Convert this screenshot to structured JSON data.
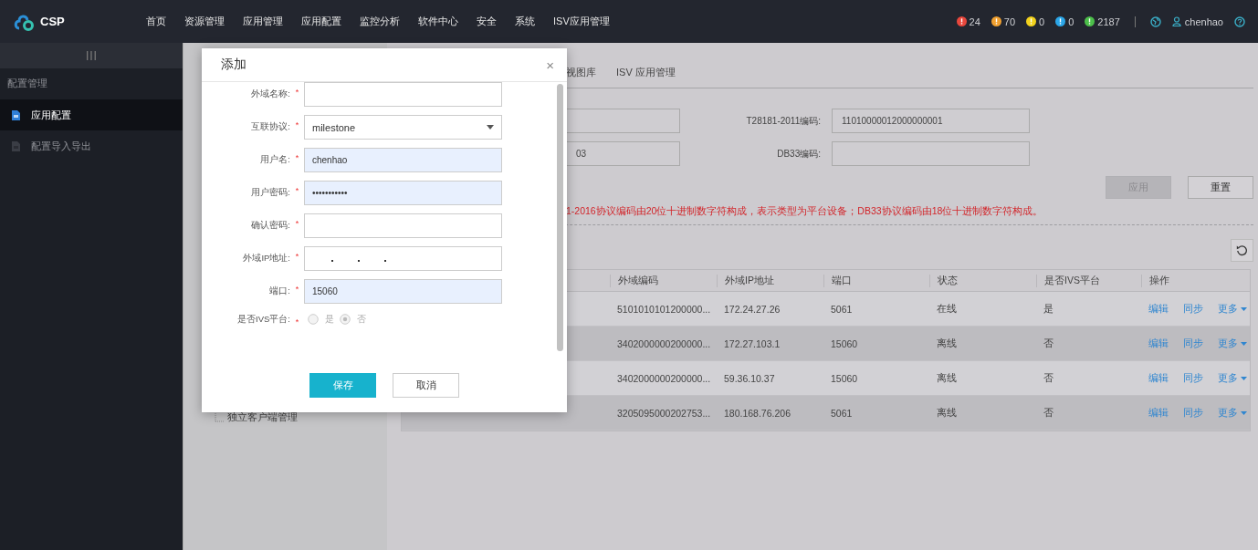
{
  "top_bar": {
    "logo_text": "CSP",
    "nav": [
      {
        "label": "首页"
      },
      {
        "label": "资源管理"
      },
      {
        "label": "应用管理"
      },
      {
        "label": "应用配置"
      },
      {
        "label": "监控分析"
      },
      {
        "label": "软件中心"
      },
      {
        "label": "安全"
      },
      {
        "label": "系统"
      },
      {
        "label": "ISV应用管理"
      }
    ],
    "alarms": [
      {
        "count": "24",
        "color": "#e8473c"
      },
      {
        "count": "70",
        "color": "#f0a030"
      },
      {
        "count": "0",
        "color": "#f2d21c"
      },
      {
        "count": "0",
        "color": "#2ba6e8"
      },
      {
        "count": "2187",
        "color": "#4cbf4a"
      }
    ],
    "user": "chenhao"
  },
  "sidebar": {
    "header": "配置管理",
    "items": [
      {
        "label": "应用配置",
        "selected": true
      },
      {
        "label": "配置导入导出",
        "selected": false
      }
    ]
  },
  "tree": {
    "items": [
      {
        "label": "独立客户端管理"
      }
    ]
  },
  "tabs": [
    {
      "label": "视图库",
      "selected": false
    },
    {
      "label": "ISV 应用管理",
      "selected": false
    }
  ],
  "codes": {
    "rows": [
      {
        "label": "T28181-2011编码:",
        "value": "11010000012000000001"
      },
      {
        "left_value": "03",
        "label": "DB33编码:"
      }
    ],
    "buttons": [
      {
        "label": "应用",
        "disabled": true
      },
      {
        "label": "重置",
        "disabled": false
      }
    ],
    "note": "1-2016协议编码由20位十进制数字符构成，表示类型为平台设备；DB33协议编码由18位十进制数字符构成。"
  },
  "table": {
    "columns": [
      "外域编码",
      "外域IP地址",
      "端口",
      "状态",
      "是否IVS平台",
      "操作"
    ],
    "rows": [
      {
        "code": "5101010101200000...",
        "ip": "172.24.27.26",
        "port": "5061",
        "status": "在线",
        "ivs": "是",
        "actions": [
          "编辑",
          "同步",
          "更多"
        ],
        "highlighted": false
      },
      {
        "code": "3402000000200000...",
        "ip": "172.27.103.1",
        "port": "15060",
        "status": "离线",
        "ivs": "否",
        "actions": [
          "编辑",
          "同步",
          "更多"
        ],
        "highlighted": true
      },
      {
        "code": "3402000000200000...",
        "ip": "59.36.10.37",
        "port": "15060",
        "status": "离线",
        "ivs": "否",
        "actions": [
          "编辑",
          "同步",
          "更多"
        ],
        "highlighted": false
      },
      {
        "code": "3205095000202753...",
        "ip": "180.168.76.206",
        "port": "5061",
        "status": "离线",
        "ivs": "否",
        "actions": [
          "编辑",
          "同步",
          "更多"
        ],
        "highlighted": true
      }
    ]
  },
  "dialog": {
    "title": "添加",
    "close": "×",
    "fields": [
      {
        "label": "外域名称:",
        "mark": "*",
        "kind": "text",
        "autofilled": false
      },
      {
        "label": "互联协议:",
        "mark": "*",
        "kind": "select",
        "value": "milestone",
        "autofilled": false
      },
      {
        "label": "用户名:",
        "mark": "*",
        "kind": "text",
        "value": "chenhao",
        "autofilled": true
      },
      {
        "label": "用户密码:",
        "mark": "*",
        "kind": "text",
        "value": "•••••••••••",
        "autofilled": true
      },
      {
        "label": "确认密码:",
        "mark": "*",
        "kind": "text",
        "autofilled": false
      },
      {
        "label": "外域IP地址:",
        "mark": "*",
        "kind": "ip",
        "autofilled": false
      },
      {
        "label": "端口:",
        "mark": "*",
        "kind": "text",
        "value": "15060",
        "autofilled": true
      },
      {
        "label": "是否IVS平台:",
        "mark": "*",
        "kind": "radio",
        "options": [
          {
            "label": "是",
            "selected": false
          },
          {
            "label": "否",
            "selected": true
          }
        ],
        "disabled": true
      }
    ],
    "buttons": [
      {
        "label": "保存",
        "primary": true
      },
      {
        "label": "取消",
        "primary": false
      }
    ]
  }
}
